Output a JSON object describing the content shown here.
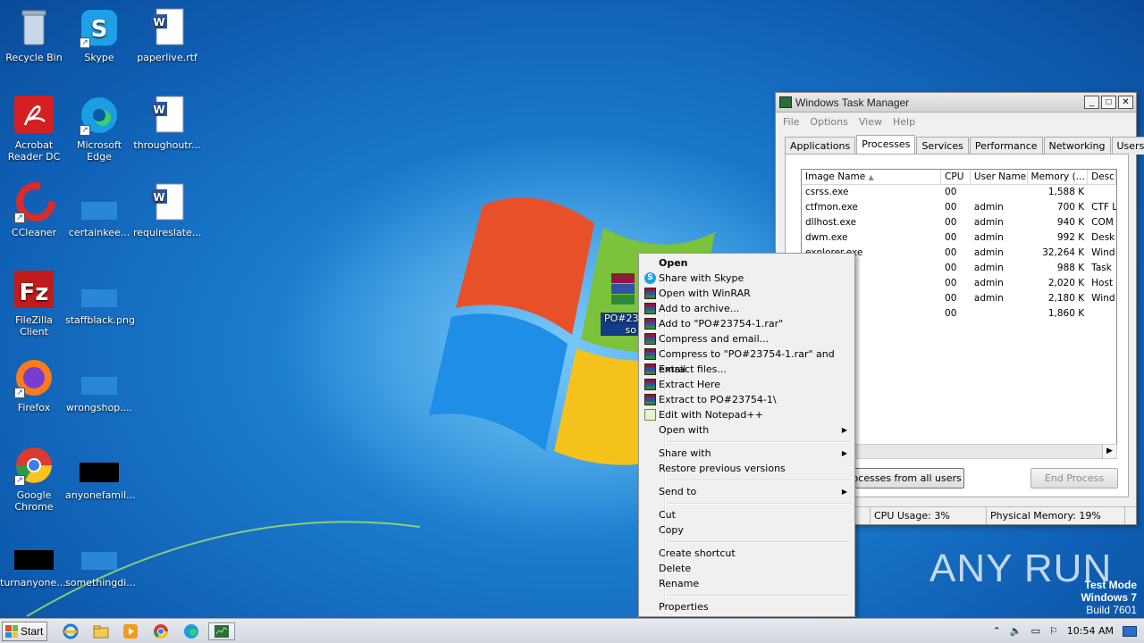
{
  "desktop": {
    "icons": [
      {
        "label": "Recycle Bin"
      },
      {
        "label": "Skype"
      },
      {
        "label": "paperlive.rtf"
      },
      {
        "label": "Acrobat Reader DC"
      },
      {
        "label": "Microsoft Edge"
      },
      {
        "label": "throughoutr..."
      },
      {
        "label": "CCleaner"
      },
      {
        "label": "certainkee..."
      },
      {
        "label": "requireslate..."
      },
      {
        "label": "FileZilla Client"
      },
      {
        "label": "staffblack.png"
      },
      {
        "label": "Firefox"
      },
      {
        "label": "wrongshop...."
      },
      {
        "label": "Google Chrome"
      },
      {
        "label": "anyonefamil..."
      },
      {
        "label": "turnanyone...."
      },
      {
        "label": "somethingdi..."
      },
      {
        "label": "PO#23754-1.rar",
        "visible_text_a": "PO#23",
        "visible_text_b": "so"
      }
    ]
  },
  "task_manager": {
    "title": "Windows Task Manager",
    "menu": [
      "File",
      "Options",
      "View",
      "Help"
    ],
    "tabs": [
      "Applications",
      "Processes",
      "Services",
      "Performance",
      "Networking",
      "Users"
    ],
    "active_tab": "Processes",
    "columns": [
      "Image Name",
      "CPU",
      "User Name",
      "Memory (...",
      "Desc"
    ],
    "rows": [
      {
        "name": "csrss.exe",
        "cpu": "00",
        "user": "",
        "mem": "1,588 K",
        "desc": ""
      },
      {
        "name": "ctfmon.exe",
        "cpu": "00",
        "user": "admin",
        "mem": "700 K",
        "desc": "CTF L"
      },
      {
        "name": "dllhost.exe",
        "cpu": "00",
        "user": "admin",
        "mem": "940 K",
        "desc": "COM"
      },
      {
        "name": "dwm.exe",
        "cpu": "00",
        "user": "admin",
        "mem": "992 K",
        "desc": "Desk"
      },
      {
        "name": "explorer.exe",
        "cpu": "00",
        "user": "admin",
        "mem": "32,264 K",
        "desc": "Wind"
      },
      {
        "name": "",
        "cpu": "00",
        "user": "admin",
        "mem": "988 K",
        "desc": "Task"
      },
      {
        "name": "",
        "cpu": "00",
        "user": "admin",
        "mem": "2,020 K",
        "desc": "Host"
      },
      {
        "name": "",
        "cpu": "00",
        "user": "admin",
        "mem": "2,180 K",
        "desc": "Wind"
      },
      {
        "name": "",
        "cpu": "00",
        "user": "",
        "mem": "1,860 K",
        "desc": ""
      }
    ],
    "show_all_button": "processes from all users",
    "end_process_button": "End Process",
    "status": {
      "cpu": "CPU Usage: 3%",
      "memory": "Physical Memory: 19%"
    }
  },
  "context_menu": {
    "items": [
      {
        "label": "Open",
        "bold": true,
        "icon": ""
      },
      {
        "label": "Share with Skype",
        "icon": "skype-icon"
      },
      {
        "label": "Open with WinRAR",
        "icon": "winrar-icon"
      },
      {
        "label": "Add to archive...",
        "icon": "winrar-icon"
      },
      {
        "label": "Add to \"PO#23754-1.rar\"",
        "icon": "winrar-icon"
      },
      {
        "label": "Compress and email...",
        "icon": "winrar-icon"
      },
      {
        "label": "Compress to \"PO#23754-1.rar\" and email",
        "icon": "winrar-icon"
      },
      {
        "label": "Extract files...",
        "icon": "winrar-icon"
      },
      {
        "label": "Extract Here",
        "icon": "winrar-icon"
      },
      {
        "label": "Extract to PO#23754-1\\",
        "icon": "winrar-icon"
      },
      {
        "label": "Edit with Notepad++",
        "icon": "notepadpp-icon"
      },
      {
        "label": "Open with",
        "submenu": true
      },
      {
        "separator": true
      },
      {
        "label": "Share with",
        "submenu": true
      },
      {
        "label": "Restore previous versions"
      },
      {
        "separator": true
      },
      {
        "label": "Send to",
        "submenu": true
      },
      {
        "separator": true
      },
      {
        "label": "Cut"
      },
      {
        "label": "Copy"
      },
      {
        "separator": true
      },
      {
        "label": "Create shortcut"
      },
      {
        "label": "Delete"
      },
      {
        "label": "Rename"
      },
      {
        "separator": true
      },
      {
        "label": "Properties"
      }
    ]
  },
  "watermark": {
    "line1": "Test Mode",
    "line2": "Windows 7",
    "line3": "Build 7601",
    "brand": "ANY RUN"
  },
  "taskbar": {
    "start_label": "Start",
    "clock": "10:54 AM",
    "pinned": [
      "ie-icon",
      "explorer-icon",
      "media-player-icon",
      "chrome-icon",
      "edge-icon",
      "task-manager-icon"
    ]
  },
  "colors": {
    "wallpaper": "#1d7fd0",
    "selection": "#123c86"
  }
}
